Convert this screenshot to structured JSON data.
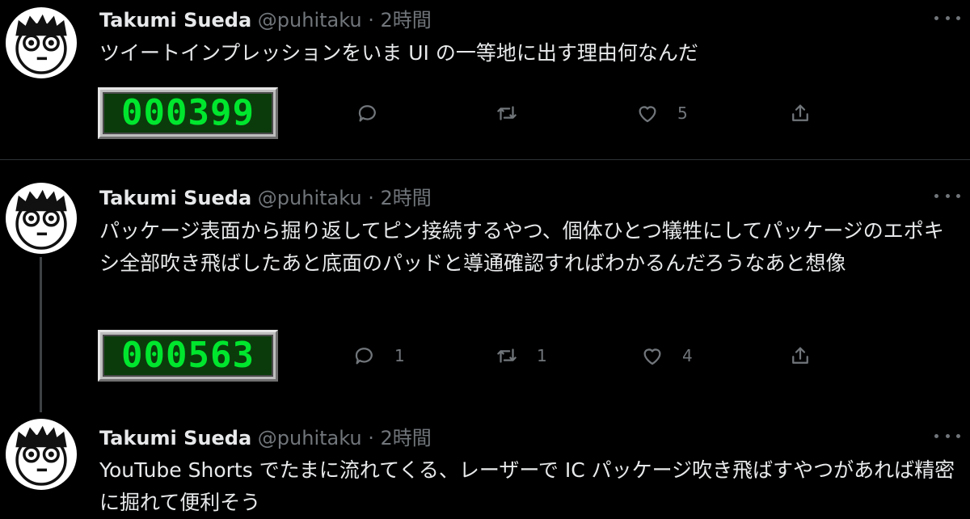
{
  "tweets": [
    {
      "author": {
        "name": "Takumi Sueda",
        "handle": "@puhitaku",
        "separator": "·",
        "time": "2時間"
      },
      "text": "ツイートインプレッションをいま UI の一等地に出す理由何なんだ",
      "impressions": "000399",
      "actions": {
        "reply": "",
        "retweet": "",
        "like": "5"
      }
    },
    {
      "author": {
        "name": "Takumi Sueda",
        "handle": "@puhitaku",
        "separator": "·",
        "time": "2時間"
      },
      "text": "パッケージ表面から掘り返してピン接続するやつ、個体ひとつ犠牲にしてパッケージのエポキシ全部吹き飛ばしたあと底面のパッドと導通確認すればわかるんだろうなあと想像",
      "impressions": "000563",
      "actions": {
        "reply": "1",
        "retweet": "1",
        "like": "4"
      }
    },
    {
      "author": {
        "name": "Takumi Sueda",
        "handle": "@puhitaku",
        "separator": "·",
        "time": "2時間"
      },
      "text": "YouTube Shorts でたまに流れてくる、レーザーで IC パッケージ吹き飛ばすやつがあれば精密に掘れて便利そう"
    }
  ],
  "icons": {
    "reply": "reply-icon",
    "retweet": "retweet-icon",
    "like": "heart-icon",
    "share": "share-icon",
    "more": "more-icon"
  },
  "colors": {
    "background": "#000000",
    "text": "#e7e9ea",
    "muted": "#71767b",
    "counter_digits": "#00e62e"
  }
}
